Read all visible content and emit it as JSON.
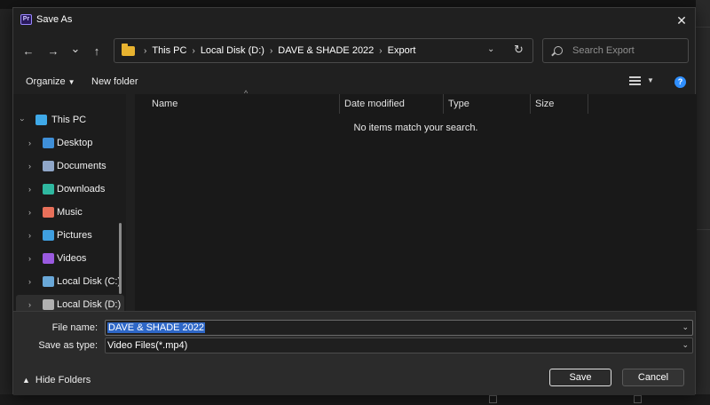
{
  "window": {
    "app_badge": "Pr",
    "title": "Save As",
    "close_glyph": "✕"
  },
  "nav": {
    "back_glyph": "←",
    "forward_glyph": "→",
    "recent_glyph": "⌄",
    "up_glyph": "↑",
    "breadcrumbs": [
      "This PC",
      "Local Disk (D:)",
      "DAVE & SHADE 2022",
      "Export"
    ],
    "crumb_separator": "›",
    "dropdown_glyph": "⌄",
    "refresh_glyph": "↻",
    "search_placeholder": "Search Export"
  },
  "commandbar": {
    "organize_label": "Organize",
    "new_folder_label": "New folder",
    "help_glyph": "?"
  },
  "sidebar": {
    "items": [
      {
        "label": "This PC",
        "icon": "computer-icon",
        "color": "#3fa9e8",
        "root": true
      },
      {
        "label": "Desktop",
        "icon": "desktop-icon",
        "color": "#3f8fd8"
      },
      {
        "label": "Documents",
        "icon": "documents-icon",
        "color": "#8fa6c8"
      },
      {
        "label": "Downloads",
        "icon": "downloads-icon",
        "color": "#2fb8a0"
      },
      {
        "label": "Music",
        "icon": "music-icon",
        "color": "#e8705a"
      },
      {
        "label": "Pictures",
        "icon": "pictures-icon",
        "color": "#3f9fe0"
      },
      {
        "label": "Videos",
        "icon": "videos-icon",
        "color": "#9a5ae0"
      },
      {
        "label": "Local Disk (C:)",
        "icon": "drive-c-icon",
        "color": "#6aa8d8"
      },
      {
        "label": "Local Disk (D:)",
        "icon": "drive-d-icon",
        "color": "#b0b0b0",
        "selected": true
      }
    ]
  },
  "filelist": {
    "columns": [
      "Name",
      "Date modified",
      "Type",
      "Size"
    ],
    "sort_glyph": "^",
    "empty_message": "No items match your search."
  },
  "footer": {
    "file_name_label": "File name:",
    "file_name_value": "DAVE & SHADE 2022",
    "save_type_label": "Save as type:",
    "save_type_value": "Video Files(*.mp4)",
    "hide_folders_label": "Hide Folders",
    "save_label": "Save",
    "cancel_label": "Cancel"
  }
}
